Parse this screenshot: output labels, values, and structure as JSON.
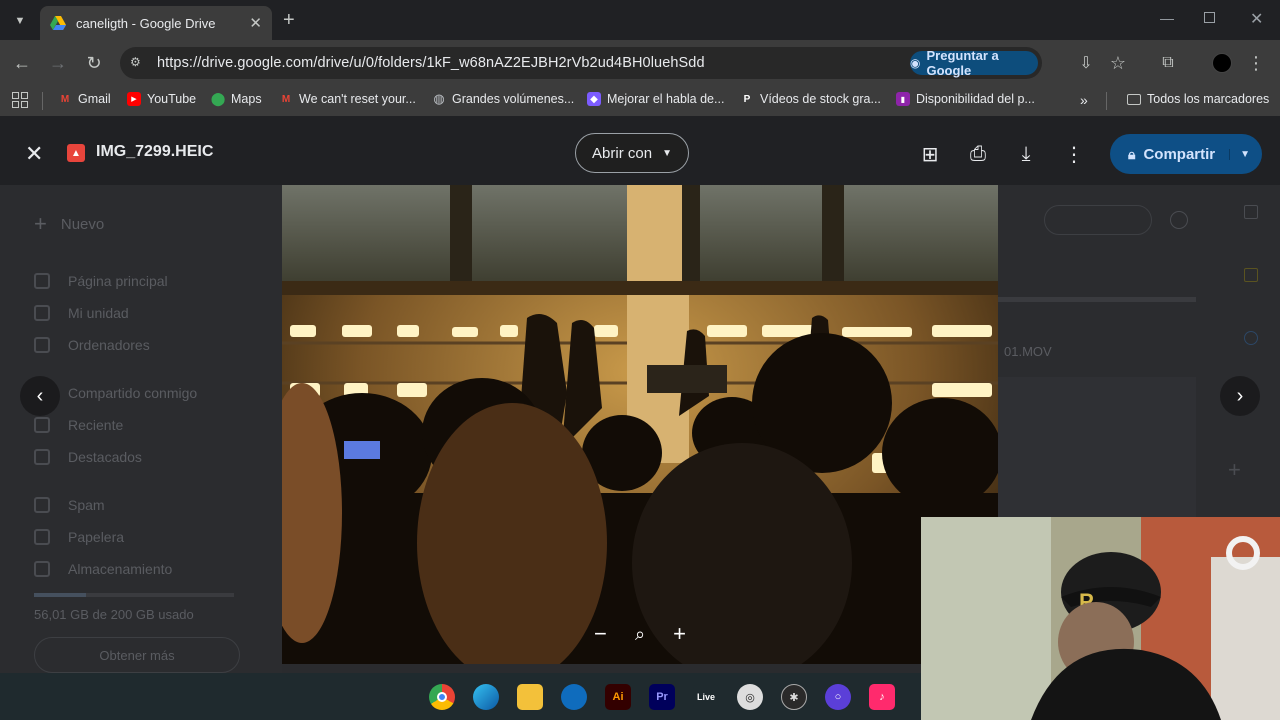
{
  "browser": {
    "tab_title": "caneligth - Google Drive",
    "url": "https://drive.google.com/drive/u/0/folders/1kF_w68nAZ2EJBH2rVb2ud4BH0luehSdd",
    "ask_google": "Preguntar a Google",
    "bookmarks": [
      {
        "label": "Gmail",
        "icon": "gmail-icon",
        "color": "#ea4335"
      },
      {
        "label": "YouTube",
        "icon": "youtube-icon",
        "color": "#ff0000"
      },
      {
        "label": "Maps",
        "icon": "maps-icon",
        "color": "#34a853"
      },
      {
        "label": "We can't reset your...",
        "icon": "gmail-icon",
        "color": "#ea4335"
      },
      {
        "label": "Grandes volúmenes...",
        "icon": "globe-icon",
        "color": "#9aa0a6"
      },
      {
        "label": "Mejorar el habla de...",
        "icon": "app-icon",
        "color": "#7c5cff"
      },
      {
        "label": "Vídeos de stock gra...",
        "icon": "pexels-icon",
        "color": "#ffffff"
      },
      {
        "label": "Disponibilidad del p...",
        "icon": "chart-icon",
        "color": "#8e24aa"
      }
    ],
    "all_bookmarks": "Todos los marcadores"
  },
  "viewer": {
    "file_name": "IMG_7299.HEIC",
    "open_with": "Abrir con",
    "share": "Compartir",
    "accent": "#0e4f86"
  },
  "drive_sidebar": {
    "new_label": "Nuevo",
    "items": [
      "Página principal",
      "Mi unidad",
      "Ordenadores",
      "Compartido conmigo",
      "Reciente",
      "Destacados",
      "Spam",
      "Papelera",
      "Almacenamiento"
    ],
    "storage": "56,01 GB de 200 GB usado",
    "get_more": "Obtener más"
  },
  "drive_right": {
    "file_hint": "01.MOV"
  }
}
